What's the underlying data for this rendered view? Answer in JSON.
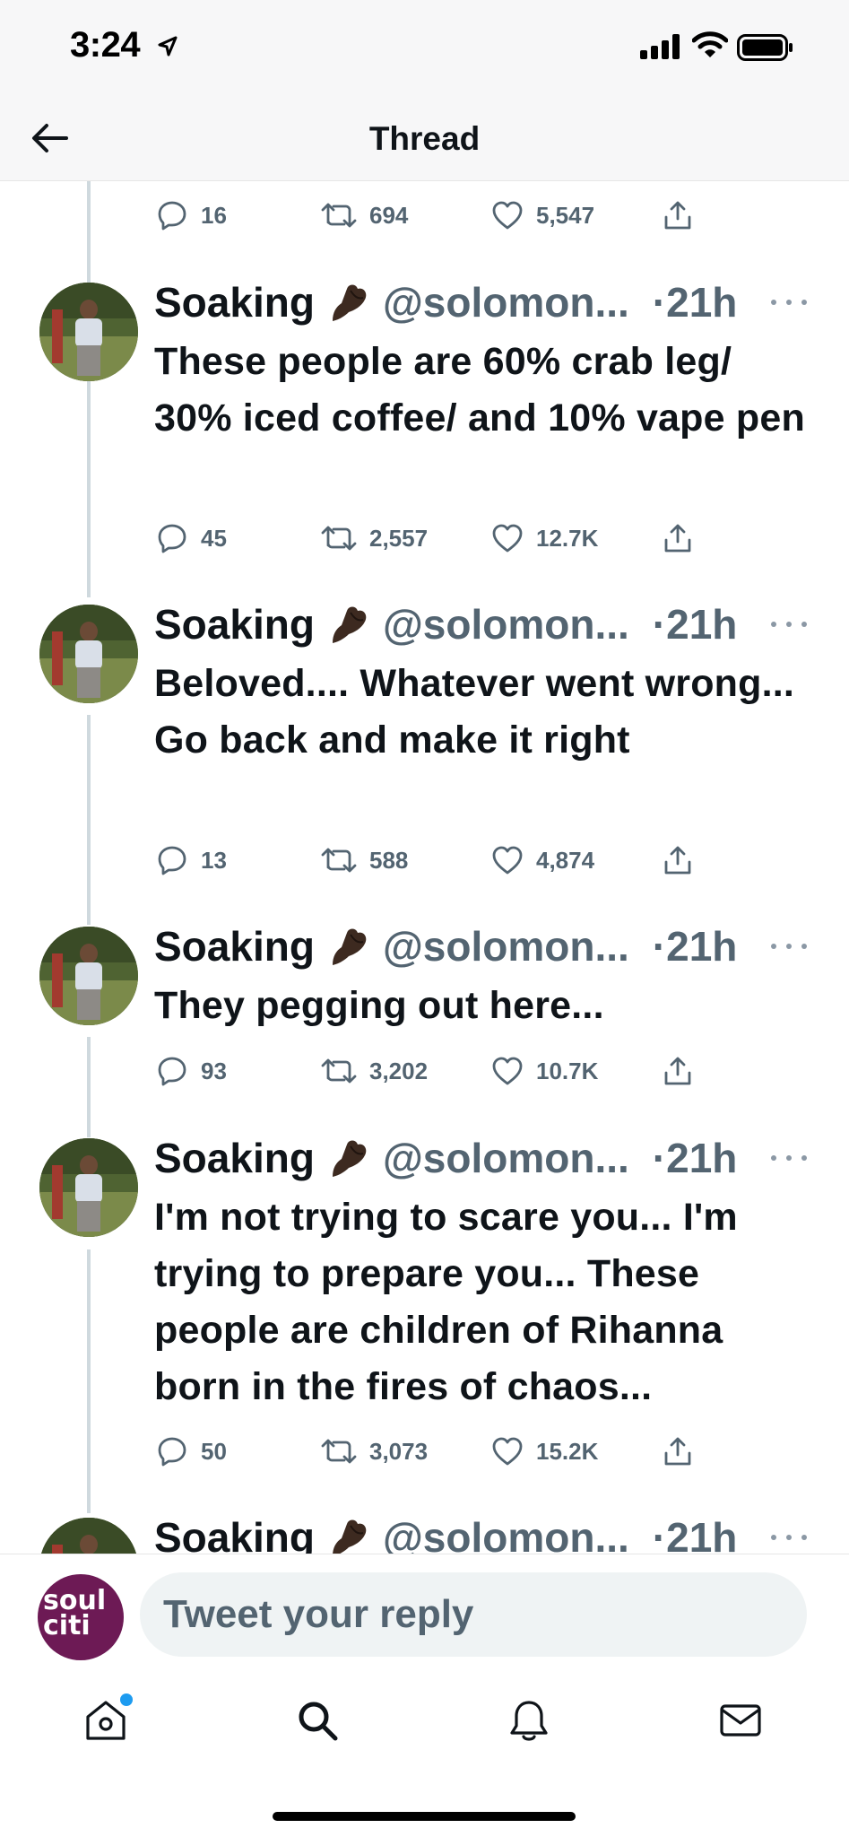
{
  "status_bar": {
    "time": "3:24",
    "icons": [
      "location-arrow-icon",
      "cellular-signal-icon",
      "wifi-icon",
      "battery-icon"
    ]
  },
  "nav": {
    "back_icon": "arrow-left-icon",
    "title": "Thread"
  },
  "top_actions": {
    "replies": "16",
    "retweets": "694",
    "likes": "5,547"
  },
  "tweets": [
    {
      "name": "Soaking",
      "emoji": "pinched-fingers-emoji",
      "handle": "@solomon...",
      "time": "21h",
      "text": "These people are 60% crab leg/ 30% iced coffee/ and 10% vape pen",
      "replies": "45",
      "retweets": "2,557",
      "likes": "12.7K"
    },
    {
      "name": "Soaking",
      "emoji": "pinched-fingers-emoji",
      "handle": "@solomon...",
      "time": "21h",
      "text": "Beloved.... Whatever went wrong... Go back and make it right",
      "replies": "13",
      "retweets": "588",
      "likes": "4,874"
    },
    {
      "name": "Soaking",
      "emoji": "pinched-fingers-emoji",
      "handle": "@solomon...",
      "time": "21h",
      "text": "They pegging out here...",
      "replies": "93",
      "retweets": "3,202",
      "likes": "10.7K"
    },
    {
      "name": "Soaking",
      "emoji": "pinched-fingers-emoji",
      "handle": "@solomon...",
      "time": "21h",
      "text": "I'm not trying to scare you... I'm trying to prepare you... These people are children of Rihanna born in the fires of chaos...",
      "replies": "50",
      "retweets": "3,073",
      "likes": "15.2K"
    },
    {
      "name": "Soaking",
      "emoji": "pinched-fingers-emoji",
      "handle": "@solomon...",
      "time": "21h",
      "text": "",
      "replies": "",
      "retweets": "",
      "likes": ""
    }
  ],
  "reply_bar": {
    "avatar_text_line1": "soul",
    "avatar_text_line2": "citi",
    "placeholder": "Tweet your reply"
  },
  "tab_bar": {
    "items": [
      "home-icon",
      "search-icon",
      "notifications-icon",
      "messages-icon"
    ],
    "home_has_new": true
  },
  "colors": {
    "text_primary": "#0f1419",
    "text_secondary": "#536471",
    "thread_line": "#cfd9de",
    "accent_blue": "#1d9bf0",
    "reply_avatar_bg": "#6d1a55"
  }
}
